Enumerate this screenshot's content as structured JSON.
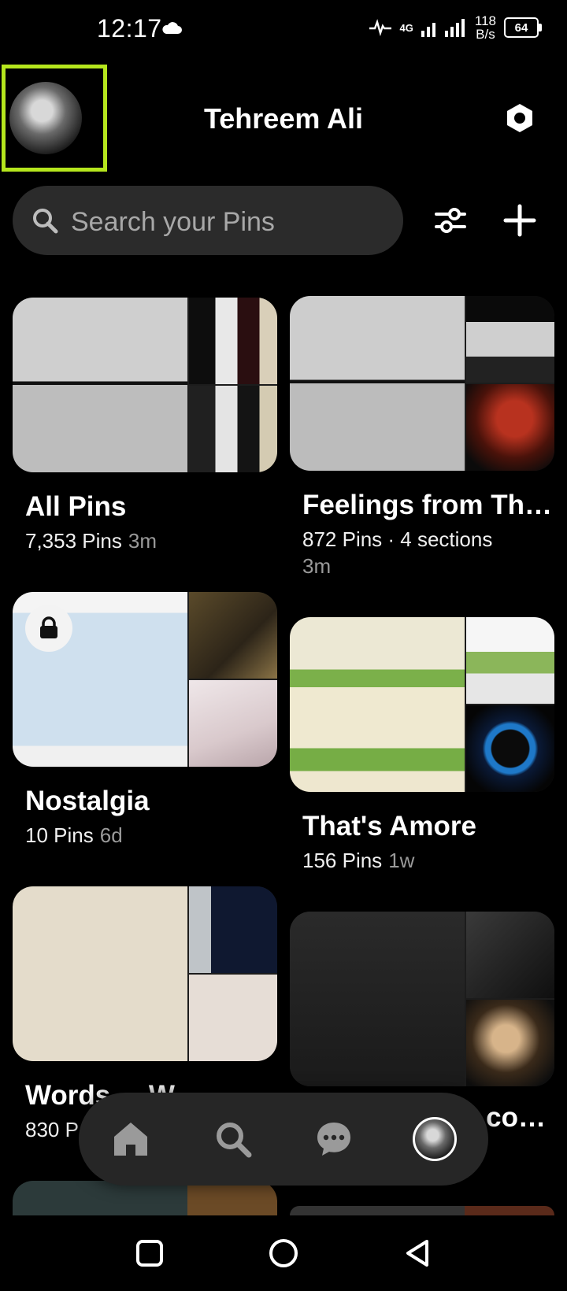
{
  "status_bar": {
    "time": "12:17",
    "network": "4G",
    "speed_value": "118",
    "speed_unit": "B/s",
    "battery": "64"
  },
  "header": {
    "title": "Tehreem Ali"
  },
  "search": {
    "placeholder": "Search your Pins"
  },
  "boards": [
    {
      "name": "All Pins",
      "count": "7,353 Pins",
      "age": "3m"
    },
    {
      "name": "Feelings from Th…",
      "count": "872 Pins · 4 sections",
      "age": "3m"
    },
    {
      "name": "Nostalgia",
      "count": "10 Pins",
      "age": "6d"
    },
    {
      "name": "That's Amore",
      "count": "156 Pins",
      "age": "1w"
    },
    {
      "name": "Words ... W",
      "count": "830 P",
      "age": ""
    },
    {
      "name": "...cot…",
      "count": "",
      "age": ""
    }
  ],
  "bottom_nav": {
    "items": [
      "home-icon",
      "search-icon",
      "messages-icon",
      "profile-avatar"
    ]
  },
  "colors": {
    "accent_frame": "#b5e61d",
    "search_bg": "#2b2b2b",
    "nav_bg": "#262626"
  }
}
